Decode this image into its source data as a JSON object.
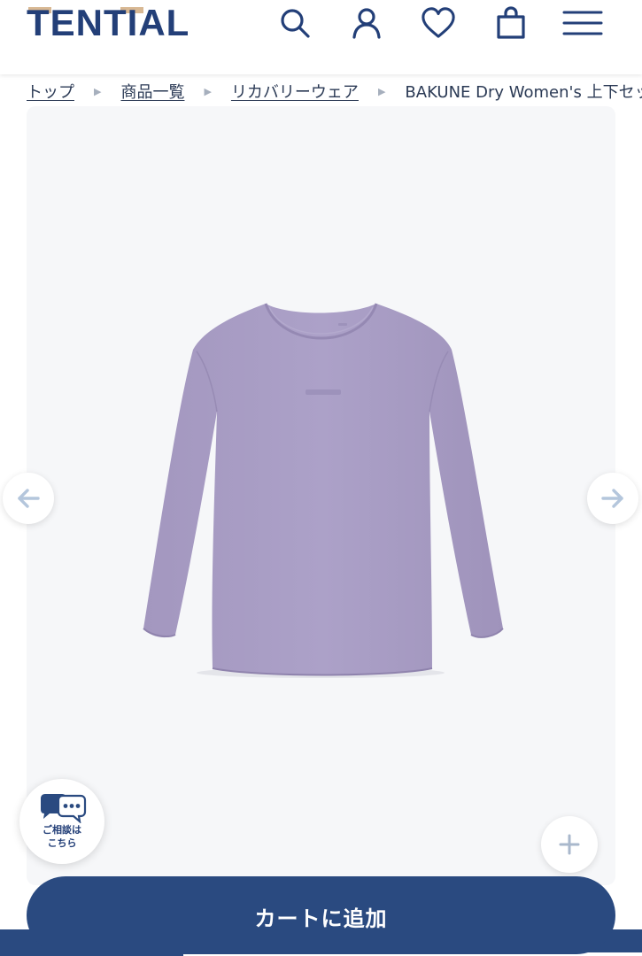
{
  "header": {
    "logo_text": "TENTIAL",
    "brand_color": "#233f78",
    "accent_color": "#d8b893",
    "icons": [
      "search-icon",
      "account-icon",
      "favorite-icon",
      "cart-icon",
      "menu-icon"
    ]
  },
  "breadcrumb": {
    "items": [
      "トップ",
      "商品一覧",
      "リカバリーウェア"
    ],
    "current": "BAKUNE Dry Women's 上下セット"
  },
  "gallery": {
    "prev_icon": "arrow-left-icon",
    "next_icon": "arrow-right-icon",
    "zoom_icon": "plus-icon",
    "product_color": "#a99ec4"
  },
  "consult": {
    "label_line1": "ご相談は",
    "label_line2": "こちら"
  },
  "cart": {
    "label": "カートに追加",
    "color": "#2a4a80"
  }
}
